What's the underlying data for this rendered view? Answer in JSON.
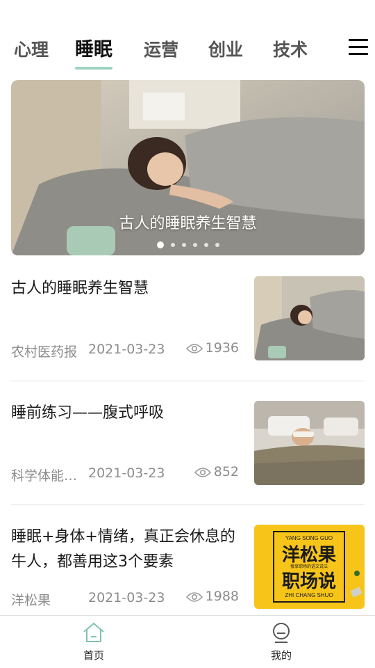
{
  "tabs": [
    {
      "label": "心理",
      "active": false
    },
    {
      "label": "睡眠",
      "active": true
    },
    {
      "label": "运营",
      "active": false
    },
    {
      "label": "创业",
      "active": false
    },
    {
      "label": "技术",
      "active": false
    }
  ],
  "menu_icon": "hamburger-menu-icon",
  "banner": {
    "caption": "古人的睡眠养生智慧",
    "slide_count": 6,
    "active_slide": 1
  },
  "articles": [
    {
      "title": "古人的睡眠养生智慧",
      "source": "农村医药报",
      "date": "2021-03-23",
      "views": "1936",
      "thumb": "woman-sleeping-photo"
    },
    {
      "title": "睡前练习——腹式呼吸",
      "source": "科学体能…",
      "date": "2021-03-23",
      "views": "852",
      "thumb": "woman-eye-mask-photo"
    },
    {
      "title": "睡眠+身体+情绪，真正会休息的牛人，都善用这3个要素",
      "source": "洋松果",
      "date": "2021-03-23",
      "views": "1988",
      "thumb": "yang-song-guo-poster"
    }
  ],
  "poster": {
    "line_top": "YANG SONG GUO",
    "line_cn_1": "洋松果",
    "line_cn_2": "职场说",
    "line_bottom": "ZHI CHANG SHUO",
    "small": "慢享职场的语文说法"
  },
  "bottom_nav": [
    {
      "label": "首页",
      "icon": "home-icon",
      "active": true
    },
    {
      "label": "我的",
      "icon": "profile-icon",
      "active": false
    }
  ],
  "colors": {
    "accent": "#9fd4c4",
    "text_primary": "#1a1a1a",
    "text_meta": "#8c8c8c",
    "poster_yellow": "#f7c51a"
  }
}
